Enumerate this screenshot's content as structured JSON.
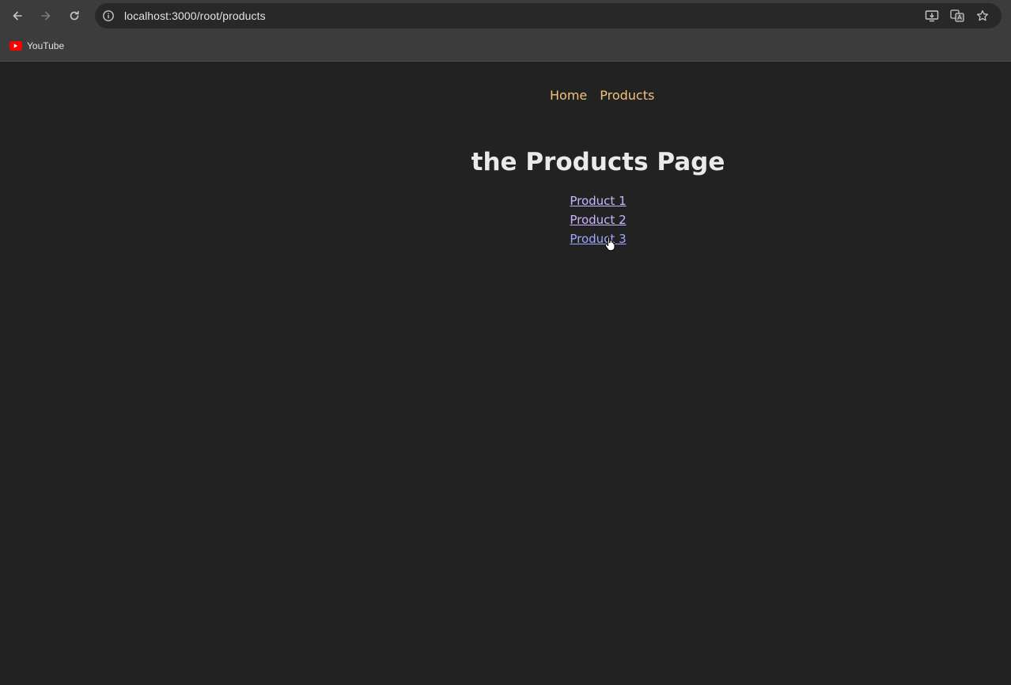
{
  "browser": {
    "url": "localhost:3000/root/products",
    "bookmarks": [
      {
        "label": "YouTube",
        "icon": "youtube-icon"
      }
    ],
    "icons": {
      "back": "back-arrow-icon",
      "forward": "forward-arrow-icon",
      "reload": "reload-icon",
      "site_info": "info-icon",
      "install": "install-app-icon",
      "translate": "translate-icon",
      "bookmark": "star-icon"
    }
  },
  "page": {
    "nav": {
      "home_label": "Home",
      "products_label": "Products"
    },
    "title": "the Products Page",
    "products": [
      {
        "label": "Product 1"
      },
      {
        "label": "Product 2"
      },
      {
        "label": "Product 3"
      }
    ]
  },
  "colors": {
    "background": "#222222",
    "nav_link": "#f0c27b",
    "product_link": "#c9b6ff",
    "title": "#eaeaea"
  }
}
